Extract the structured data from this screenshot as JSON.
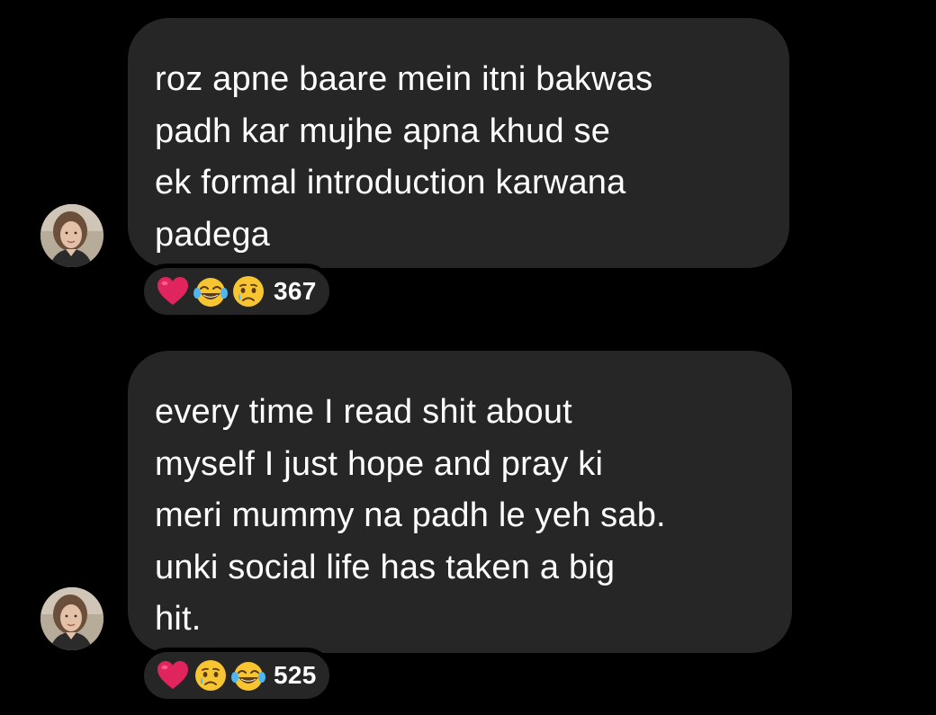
{
  "comments": [
    {
      "text": "roz apne baare mein itni bakwas\npadh kar mujhe apna khud se\nek formal introduction karwana\npadega",
      "reactions": [
        "red-heart",
        "laughing-tears",
        "crying"
      ],
      "reaction_count": "367"
    },
    {
      "text": "every time I read shit about\nmyself I just hope and pray ki\nmeri mummy na padh le yeh sab.\nunki social life has taken a big\nhit.",
      "reactions": [
        "red-heart",
        "crying",
        "laughing-tears"
      ],
      "reaction_count": "525"
    }
  ],
  "colors": {
    "background": "#000000",
    "bubble": "#262626",
    "text": "#ffffff",
    "heart": "#e0245e",
    "emoji_face": "#f7c531"
  }
}
